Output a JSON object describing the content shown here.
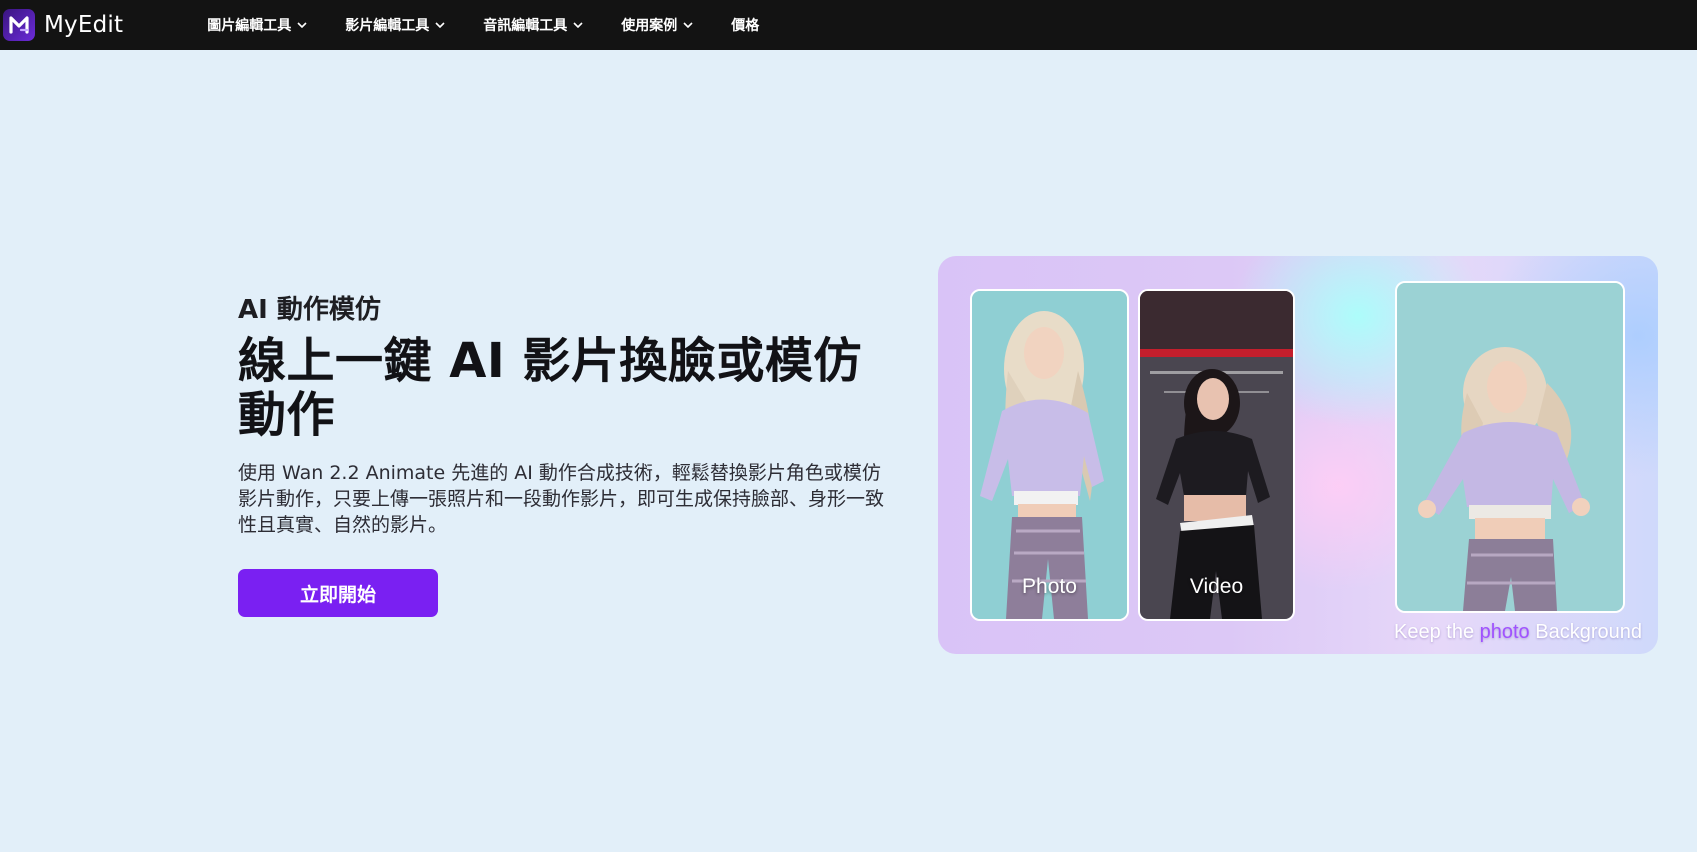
{
  "brand": {
    "name": "MyEdit",
    "logo_letter": "M"
  },
  "nav": {
    "items": [
      {
        "label": "圖片編輯工具",
        "has_dropdown": true
      },
      {
        "label": "影片編輯工具",
        "has_dropdown": true
      },
      {
        "label": "音訊編輯工具",
        "has_dropdown": true
      },
      {
        "label": "使用案例",
        "has_dropdown": true
      },
      {
        "label": "價格",
        "has_dropdown": false
      }
    ]
  },
  "hero": {
    "eyebrow": "AI 動作模仿",
    "headline": "線上一鍵 AI 影片換臉或模仿動作",
    "description": "使用 Wan 2.2 Animate 先進的 AI 動作合成技術，輕鬆替換影片角色或模仿影片動作，只要上傳一張照片和一段動作影片，即可生成保持臉部、身形一致性且真實、自然的影片。",
    "cta_label": "立即開始"
  },
  "showcase": {
    "panels": [
      {
        "label": "Photo"
      },
      {
        "label": "Video"
      },
      {
        "label": ""
      }
    ],
    "caption": {
      "before": "Keep the ",
      "highlight": "photo",
      "after": " Background"
    }
  },
  "colors": {
    "topbar_bg": "#131313",
    "page_bg": "#e2eff9",
    "cta_bg": "#7a20f2",
    "caption_highlight": "#a052ff"
  },
  "icons": {
    "logo": "myedit-logo-icon",
    "dropdown": "chevron-down-icon"
  }
}
